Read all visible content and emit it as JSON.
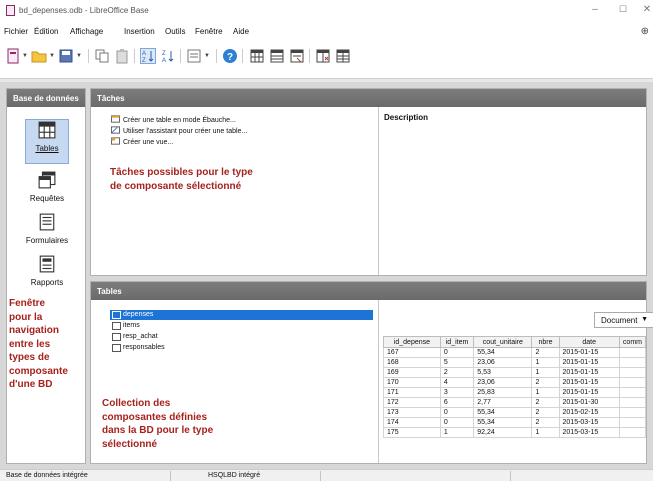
{
  "window": {
    "title": "bd_depenses.odb - LibreOffice Base",
    "minimize": "–",
    "maximize": "☐",
    "close": "✕"
  },
  "menu": {
    "items": [
      "Fichier",
      "Édition",
      "Affichage",
      "Insertion",
      "Outils",
      "Fenêtre",
      "Aide"
    ],
    "help_icon": "⊕"
  },
  "toolbar": {
    "icons": [
      "new-database-icon",
      "open-icon",
      "save-icon",
      "copy-icon",
      "paste-icon",
      "sort-ascending-icon",
      "sort-descending-icon",
      "form-icon",
      "help-icon",
      "table-icon",
      "query-icon",
      "form-design-icon",
      "report-icon",
      "report-view-icon"
    ]
  },
  "left_panel": {
    "header": "Base de données",
    "items": [
      {
        "label": "Tables",
        "icon": "table-icon",
        "selected": true
      },
      {
        "label": "Requêtes",
        "icon": "query-icon",
        "selected": false
      },
      {
        "label": "Formulaires",
        "icon": "form-icon",
        "selected": false
      },
      {
        "label": "Rapports",
        "icon": "report-icon",
        "selected": false
      }
    ]
  },
  "tasks_panel": {
    "header": "Tâches",
    "tasks": [
      "Créer une table en mode Ébauche...",
      "Utiliser l'assistant pour créer une table...",
      "Créer une vue..."
    ],
    "description_label": "Description"
  },
  "tables_panel": {
    "header": "Tables",
    "items": [
      "depenses",
      "items",
      "resp_achat",
      "responsables"
    ],
    "selected": "depenses",
    "view_select": "Document",
    "grid": {
      "columns": [
        "id_depense",
        "id_item",
        "cout_unitaire",
        "nbre",
        "date",
        "comm"
      ],
      "rows": [
        [
          "167",
          "0",
          "55,34",
          "2",
          "2015-01-15",
          ""
        ],
        [
          "168",
          "5",
          "23,06",
          "1",
          "2015-01-15",
          ""
        ],
        [
          "169",
          "2",
          "5,53",
          "1",
          "2015-01-15",
          ""
        ],
        [
          "170",
          "4",
          "23,06",
          "2",
          "2015-01-15",
          ""
        ],
        [
          "171",
          "3",
          "25,83",
          "1",
          "2015-01-15",
          ""
        ],
        [
          "172",
          "6",
          "2,77",
          "2",
          "2015-01-30",
          ""
        ],
        [
          "173",
          "0",
          "55,34",
          "2",
          "2015-02-15",
          ""
        ],
        [
          "174",
          "0",
          "55,34",
          "2",
          "2015-03-15",
          ""
        ],
        [
          "175",
          "1",
          "92,24",
          "1",
          "2015-03-15",
          ""
        ]
      ]
    }
  },
  "annotations": {
    "tasks_note": [
      "Tâches possibles pour le type",
      "de composante sélectionné"
    ],
    "nav_note": [
      "Fenêtre",
      "pour la",
      "navigation",
      "entre les",
      "types de",
      "composante",
      "d'une BD"
    ],
    "collection_note": [
      "Collection des",
      "composantes définies",
      "dans la BD pour le type",
      "sélectionné"
    ]
  },
  "statusbar": {
    "left": "Base de données intégrée",
    "middle": "HSQLBD intégré"
  },
  "colors": {
    "annotation": "#a5221d",
    "selection": "#1e73d6",
    "panel_header": "#727272"
  }
}
